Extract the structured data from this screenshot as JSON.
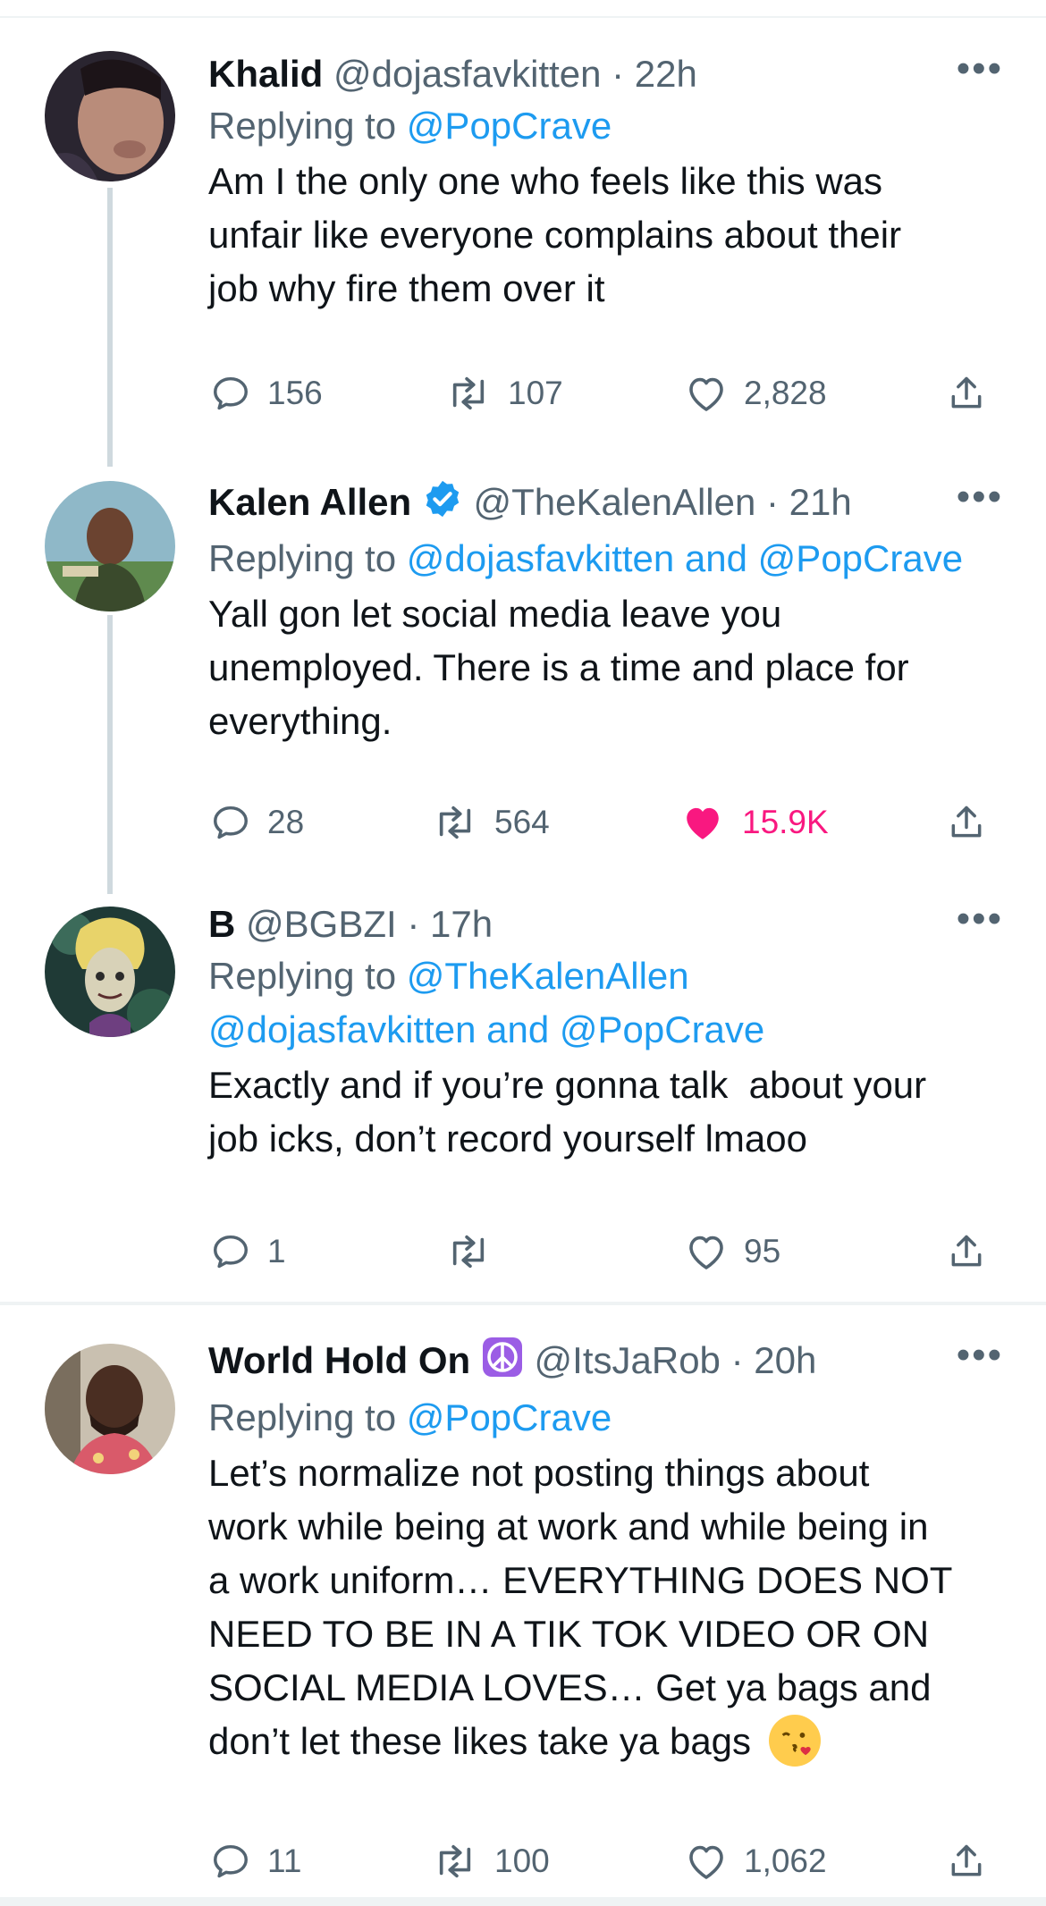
{
  "colors": {
    "accent": "#1d9bf0",
    "like": "#f91880",
    "muted": "#536471",
    "text": "#0f1419",
    "divider": "#eff3f4",
    "peace_purple": "#9b5de5"
  },
  "tweets": [
    {
      "name": "Khalid",
      "handle": "@dojasfavkitten",
      "time": "· 22h",
      "reply_prefix": "Replying to",
      "reply_line1": "@PopCrave",
      "reply_line2": "",
      "body_lines": [
        "Am I the only one who feels like this was",
        "unfair like everyone complains about their",
        "job why fire them over it"
      ],
      "replies": "156",
      "retweets": "107",
      "likes": "2,828",
      "liked": false
    },
    {
      "name": "Kalen Allen",
      "verified_icon": "verified-badge-icon",
      "handle": "@TheKalenAllen",
      "time": "· 21h",
      "reply_prefix": "Replying to",
      "reply_line1": "@dojasfavkitten and @PopCrave",
      "reply_line2": "",
      "body_lines": [
        "Yall gon let social media leave you",
        "unemployed. There is a time and place for",
        "everything."
      ],
      "replies": "28",
      "retweets": "564",
      "likes": "15.9K",
      "liked": true
    },
    {
      "name": "B",
      "handle": "@BGBZI",
      "time": "· 17h",
      "reply_prefix": "Replying to",
      "reply_line1": "@TheKalenAllen",
      "reply_line2": "@dojasfavkitten and @PopCrave",
      "body_lines": [
        "Exactly and if you’re gonna talk  about your",
        "job icks, don’t record yourself lmaoo"
      ],
      "replies": "1",
      "retweets": "",
      "likes": "95",
      "liked": false
    },
    {
      "name": "World Hold On",
      "name_icon": "peace-symbol-icon",
      "handle": "@ItsJaRob",
      "time": "· 20h",
      "reply_prefix": "Replying to",
      "reply_line1": "@PopCrave",
      "reply_line2": "",
      "body_lines": [
        "Let’s normalize not posting things about",
        "work while being at work and while being in",
        "a work uniform… EVERYTHING DOES NOT",
        "NEED TO BE IN A TIK TOK VIDEO OR ON",
        "SOCIAL MEDIA LOVES… Get ya bags and",
        "don’t let these likes take ya bags"
      ],
      "body_emoji": "face-blowing-kiss-emoji",
      "replies": "11",
      "retweets": "100",
      "likes": "1,062",
      "liked": false
    }
  ]
}
